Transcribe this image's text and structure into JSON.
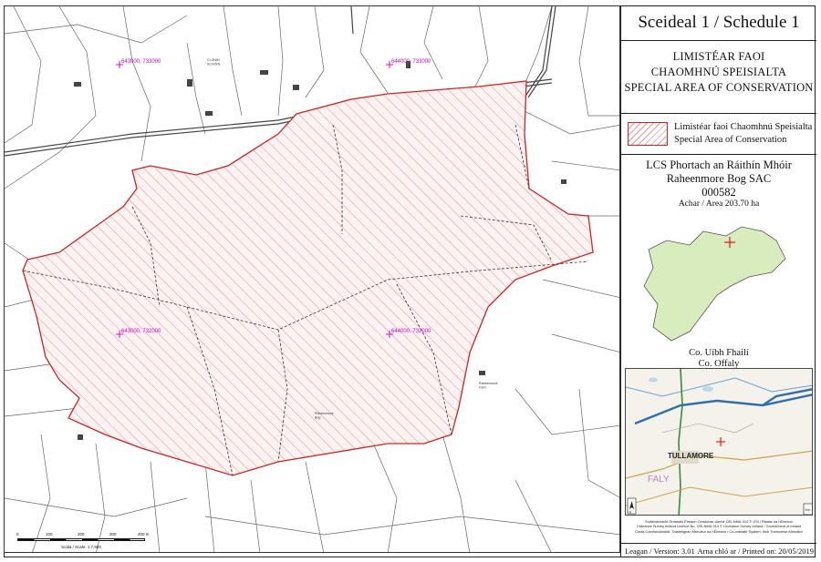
{
  "schedule_title": "Sceideal 1 / Schedule 1",
  "sac_heading": {
    "line1": "LIMISTÉAR FAOI",
    "line2": "CHAOMHNÚ SPEISIALTA",
    "line3": "SPECIAL AREA OF CONSERVATION"
  },
  "legend": {
    "label_irish": "Limistéar faoi Chaomhnú Speisialta",
    "label_english": "Special Area of Conservation",
    "fill_color": "#e79999",
    "outline_color": "#d22222"
  },
  "site": {
    "name_irish": "LCS Phortach an Ráithín Mhóir",
    "name_english": "Raheenmore Bog SAC",
    "code": "000582",
    "area": "Achar / Area 203.70 ha"
  },
  "county": {
    "name_irish": "Co. Uíbh Fhailí",
    "name_english": "Co. Offaly"
  },
  "locator": {
    "town_label": "TULLAMORE",
    "region_label": "FALY",
    "north_label": "N",
    "scale_label": "Km"
  },
  "grid_labels": {
    "top_left": "643000, 733000",
    "top_right": "644000, 733000",
    "bottom_left": "643000, 732000",
    "bottom_right": "644000, 732000"
  },
  "map_labels": {
    "house_a": "CLONIN\nSCHOOL",
    "bog": "Raheenmore\nBog",
    "farm": "Raheenmore\nFarm"
  },
  "copyright_lines": [
    "Suirbhéireacht Ordanáis Éireann Ceadúnas Uimhir OSI-NMA-014 © OSi / Rialtas na hÉireann",
    "Ordnance Survey Ireland Licence No. OSI-NMA-014 © Ordnance Survey Ireland / Government of Ireland",
    "Córas Comhordanáidí: Trasteilgean Mercator na hÉireann / Co-ordinate System: Irish Transverse Mercator"
  ],
  "footer": {
    "version": "Leagan / Version: 3.01",
    "printed": "Arna chló ar / Printed on: 20/05/2019"
  },
  "scale": {
    "ticks": [
      "0",
      "100",
      "200",
      "300",
      "400 m"
    ],
    "caption": "Scála / Scale: 1:7,500"
  },
  "colors": {
    "grid_label": "#d000c8",
    "road": "#444444",
    "field_line": "#555555"
  }
}
